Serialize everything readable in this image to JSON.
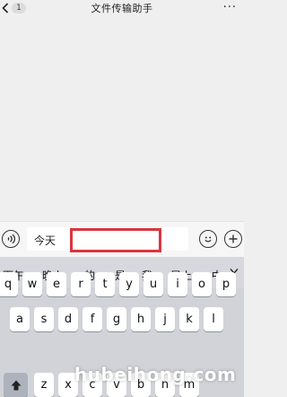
{
  "header": {
    "back_badge": "1",
    "title": "文件传输助手",
    "more_label": "···"
  },
  "input_bar": {
    "draft_text": "今天",
    "icons": [
      "voice-icon",
      "emoji-icon",
      "plus-icon"
    ]
  },
  "keyboard": {
    "candidates": [
      "下午",
      "晚上",
      "的",
      "是",
      "我",
      "早上",
      "中"
    ],
    "row1": [
      "q",
      "w",
      "e",
      "r",
      "t",
      "y",
      "u",
      "i",
      "o",
      "p"
    ],
    "row2": [
      "a",
      "s",
      "d",
      "f",
      "g",
      "h",
      "j",
      "k",
      "l"
    ],
    "row3": [
      "z",
      "x",
      "c",
      "v",
      "b",
      "n",
      "m"
    ]
  },
  "watermark": "hubeihong.com",
  "colors": {
    "highlight": "#d9363e",
    "keyboard_bg": "#d1d3d9",
    "key_bg": "#ffffff",
    "chat_bg": "#efefef"
  }
}
